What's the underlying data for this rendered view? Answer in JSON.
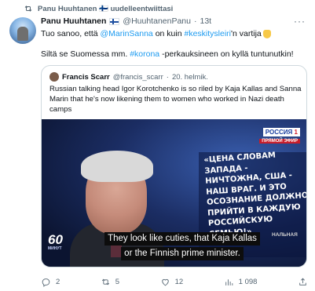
{
  "retweet": {
    "icon": "retweet-icon",
    "text": "Panu Huuhtanen 🇫🇮 uudelleentwiittasi"
  },
  "tweet": {
    "author_name": "Panu Huuhtanen",
    "author_flag": "finland-flag-icon",
    "handle": "@HuuhtanenPanu",
    "dot": "·",
    "time": "13t",
    "text1_a": "Tuo sanoo, että ",
    "text1_mention": "@MarinSanna",
    "text1_b": " on kuin ",
    "text1_hashtag": "#keskitysleiri",
    "text1_c": "'n vartija",
    "text2_a": "Siltä se Suomessa mm. ",
    "text2_hashtag": "#korona",
    "text2_b": " -perkauksineen on kyllä tuntunutkin!"
  },
  "quoted": {
    "author_name": "Francis Scarr",
    "handle": "@francis_scarr",
    "dot": "·",
    "time": "20. helmik.",
    "text": "Russian talking head Igor Korotchenko is so riled by Kaja Kallas and Sanna Marin that he's now likening them to women who worked in Nazi death camps",
    "media": {
      "channel_logo_top": "РОССИЯ",
      "channel_logo_num": "1",
      "channel_logo_sub": "ПРЯМОЙ ЭФИР",
      "show_badge": "60",
      "show_badge_sub": "МИНУТ",
      "quote_text": "«ЦЕНА СЛОВАМ ЗАПАДА - НИЧТОЖНА, США - НАШ ВРАГ. И ЭТО ОСОЗНАНИЕ ДОЛЖНО ПРИЙТИ В КАЖДУЮ РОССИЙСКУЮ СЕМЬЮ!»",
      "caption_line1": "They look like cuties, that Kaja Kallas",
      "caption_line2": "or the Finnish prime minister.",
      "caption_tail": "НАЛЬНАЯ"
    }
  },
  "actions": {
    "reply_count": "2",
    "retweet_count": "5",
    "like_count": "12",
    "views_count": "1 098"
  }
}
